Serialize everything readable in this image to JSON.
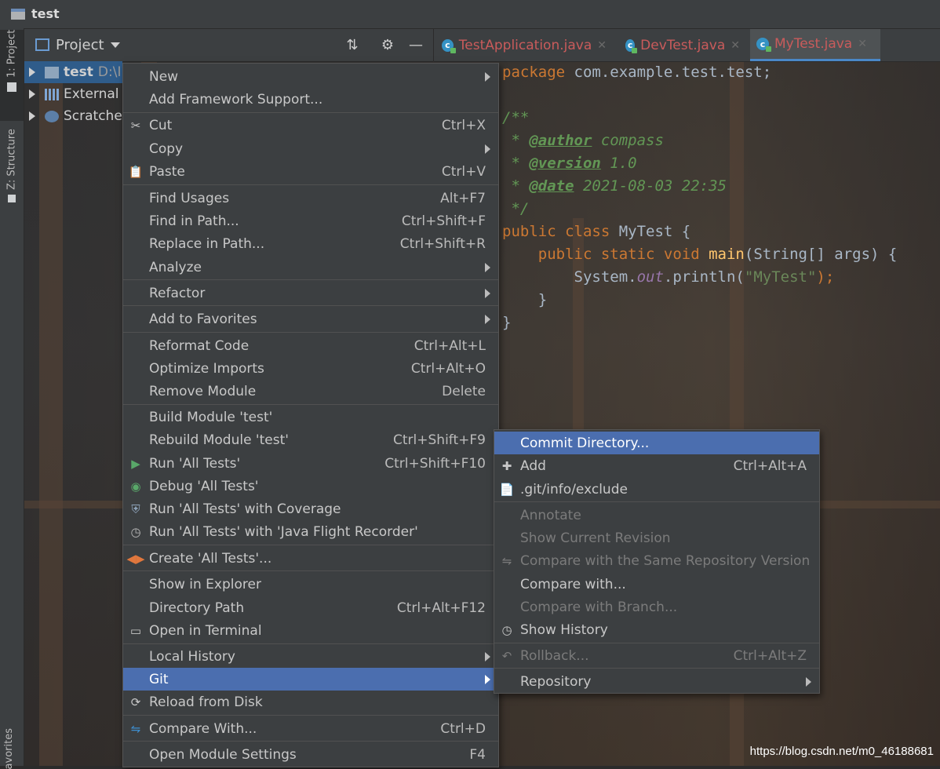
{
  "window": {
    "title": "test"
  },
  "left_strip": {
    "project_tab": "1: Project",
    "structure_tab": "Z: Structure",
    "favorites_tab": "avorites"
  },
  "project_panel": {
    "title": "Project"
  },
  "tree": [
    {
      "label": "test",
      "path": "D:\\I"
    },
    {
      "label": "External"
    },
    {
      "label": "Scratche"
    }
  ],
  "editor_tabs": [
    {
      "label": "TestApplication.java"
    },
    {
      "label": "DevTest.java"
    },
    {
      "label": "MyTest.java",
      "active": true
    }
  ],
  "code": {
    "line1_kw": "package",
    "line1_rest": " com.example.test.test;",
    "line3": "/**",
    "line4_pre": " * ",
    "line4_tag": "@author",
    "line4_val": " compass",
    "line5_pre": " * ",
    "line5_tag": "@version",
    "line5_val": " 1.0",
    "line6_pre": " * ",
    "line6_tag": "@date",
    "line6_val": " 2021-08-03 22:35",
    "line7": " */",
    "line8_kw": "public class",
    "line8_rest": " MyTest {",
    "line9_ind": "    ",
    "line9_kw": "public static void",
    "line9_fn": " main",
    "line9_rest": "(String[] args) {",
    "line10_ind": "        ",
    "line10_a": "System.",
    "line10_fld": "out",
    "line10_b": ".println(",
    "line10_str": "\"MyTest\"",
    "line10_c": ");",
    "line11": "    }",
    "line12": "}"
  },
  "context_menu": {
    "items": [
      {
        "label": "New",
        "submenu": true
      },
      {
        "label": "Add Framework Support..."
      },
      {
        "label": "Cut",
        "shortcut": "Ctrl+X"
      },
      {
        "label": "Copy",
        "submenu": true
      },
      {
        "label": "Paste",
        "shortcut": "Ctrl+V"
      },
      {
        "label": "Find Usages",
        "shortcut": "Alt+F7"
      },
      {
        "label": "Find in Path...",
        "shortcut": "Ctrl+Shift+F"
      },
      {
        "label": "Replace in Path...",
        "shortcut": "Ctrl+Shift+R"
      },
      {
        "label": "Analyze",
        "submenu": true
      },
      {
        "label": "Refactor",
        "submenu": true
      },
      {
        "label": "Add to Favorites",
        "submenu": true
      },
      {
        "label": "Reformat Code",
        "shortcut": "Ctrl+Alt+L"
      },
      {
        "label": "Optimize Imports",
        "shortcut": "Ctrl+Alt+O"
      },
      {
        "label": "Remove Module",
        "shortcut": "Delete"
      },
      {
        "label": "Build Module 'test'"
      },
      {
        "label": "Rebuild Module 'test'",
        "shortcut": "Ctrl+Shift+F9"
      },
      {
        "label": "Run 'All Tests'",
        "shortcut": "Ctrl+Shift+F10"
      },
      {
        "label": "Debug 'All Tests'"
      },
      {
        "label": "Run 'All Tests' with Coverage"
      },
      {
        "label": "Run 'All Tests' with 'Java Flight Recorder'"
      },
      {
        "label": "Create 'All Tests'..."
      },
      {
        "label": "Show in Explorer"
      },
      {
        "label": "Directory Path",
        "shortcut": "Ctrl+Alt+F12"
      },
      {
        "label": "Open in Terminal"
      },
      {
        "label": "Local History",
        "submenu": true
      },
      {
        "label": "Git",
        "submenu": true,
        "highlighted": true
      },
      {
        "label": "Reload from Disk"
      },
      {
        "label": "Compare With...",
        "shortcut": "Ctrl+D"
      },
      {
        "label": "Open Module Settings",
        "shortcut": "F4"
      }
    ]
  },
  "git_submenu": {
    "items": [
      {
        "label": "Commit Directory...",
        "highlighted": true
      },
      {
        "label": "Add",
        "shortcut": "Ctrl+Alt+A"
      },
      {
        "label": ".git/info/exclude"
      },
      {
        "label": "Annotate",
        "disabled": true
      },
      {
        "label": "Show Current Revision",
        "disabled": true
      },
      {
        "label": "Compare with the Same Repository Version",
        "disabled": true
      },
      {
        "label": "Compare with..."
      },
      {
        "label": "Compare with Branch...",
        "disabled": true
      },
      {
        "label": "Show History"
      },
      {
        "label": "Rollback...",
        "shortcut": "Ctrl+Alt+Z",
        "disabled": true
      },
      {
        "label": "Repository",
        "submenu": true
      }
    ]
  },
  "watermark": "https://blog.csdn.net/m0_46188681"
}
